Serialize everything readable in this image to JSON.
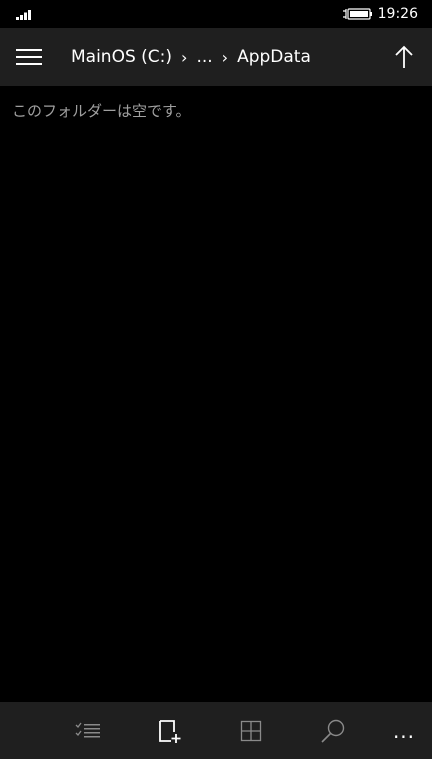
{
  "status_bar": {
    "time": "19:26",
    "icons": [
      "signal-icon",
      "battery-charging-icon"
    ]
  },
  "header": {
    "menu_icon": "hamburger-icon",
    "breadcrumb": {
      "root": "MainOS (C:)",
      "ellipsis": "...",
      "current": "AppData",
      "separator": "›"
    },
    "up_icon": "arrow-up-icon"
  },
  "content": {
    "empty_message": "このフォルダーは空です。"
  },
  "app_bar": {
    "buttons": [
      {
        "icon": "select-list-icon"
      },
      {
        "icon": "new-folder-icon"
      },
      {
        "icon": "grid-view-icon"
      },
      {
        "icon": "search-icon"
      }
    ],
    "more": "..."
  },
  "colors": {
    "background": "#000000",
    "bar_background": "#1f1f1f",
    "text": "#ffffff",
    "muted_text": "#a0a0a0",
    "icon_dim": "#8a8a8a"
  }
}
